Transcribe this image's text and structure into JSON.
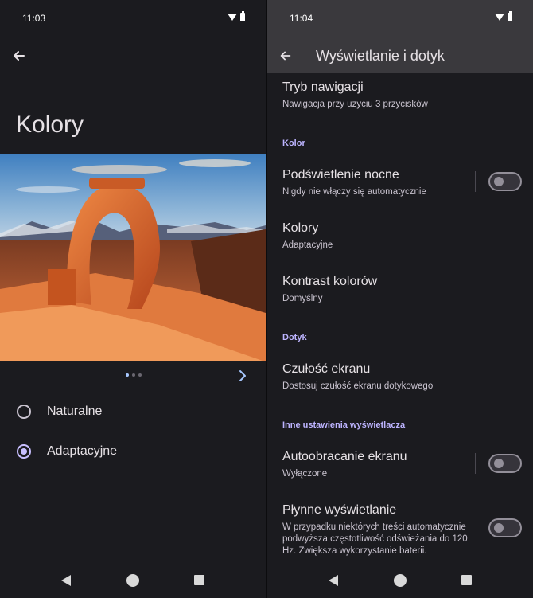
{
  "left": {
    "status": {
      "time": "11:03"
    },
    "title": "Kolory",
    "options": [
      {
        "label": "Naturalne",
        "checked": false
      },
      {
        "label": "Adaptacyjne",
        "checked": true
      }
    ],
    "carousel": {
      "page": 1,
      "pages": 3
    }
  },
  "right": {
    "status": {
      "time": "11:04"
    },
    "title": "Wyświetlanie i dotyk",
    "nav_mode": {
      "title": "Tryb nawigacji",
      "subtitle": "Nawigacja przy użyciu 3 przycisków"
    },
    "section_color": "Kolor",
    "night_light": {
      "title": "Podświetlenie nocne",
      "subtitle": "Nigdy nie włączy się automatycznie",
      "on": false
    },
    "colors": {
      "title": "Kolory",
      "subtitle": "Adaptacyjne"
    },
    "contrast": {
      "title": "Kontrast kolorów",
      "subtitle": "Domyślny"
    },
    "section_touch": "Dotyk",
    "touch_sensitivity": {
      "title": "Czułość ekranu",
      "subtitle": "Dostosuj czułość ekranu dotykowego"
    },
    "section_other": "Inne ustawienia wyświetlacza",
    "auto_rotate": {
      "title": "Autoobracanie ekranu",
      "subtitle": "Wyłączone",
      "on": false
    },
    "smooth_display": {
      "title": "Płynne wyświetlanie",
      "subtitle": "W przypadku niektórych treści automatycznie podwyższa częstotliwość odświeżania do 120 Hz. Zwiększa wykorzystanie baterii.",
      "on": false
    }
  },
  "colors": {
    "accent": "#c8bfff",
    "section": "#bdb4ff",
    "background": "#1b1b1f",
    "appbar": "#3a393d"
  },
  "icons": [
    "back-arrow-icon",
    "chevron-right-icon",
    "wifi-icon",
    "battery-icon",
    "nav-back-icon",
    "nav-home-icon",
    "nav-recents-icon"
  ]
}
